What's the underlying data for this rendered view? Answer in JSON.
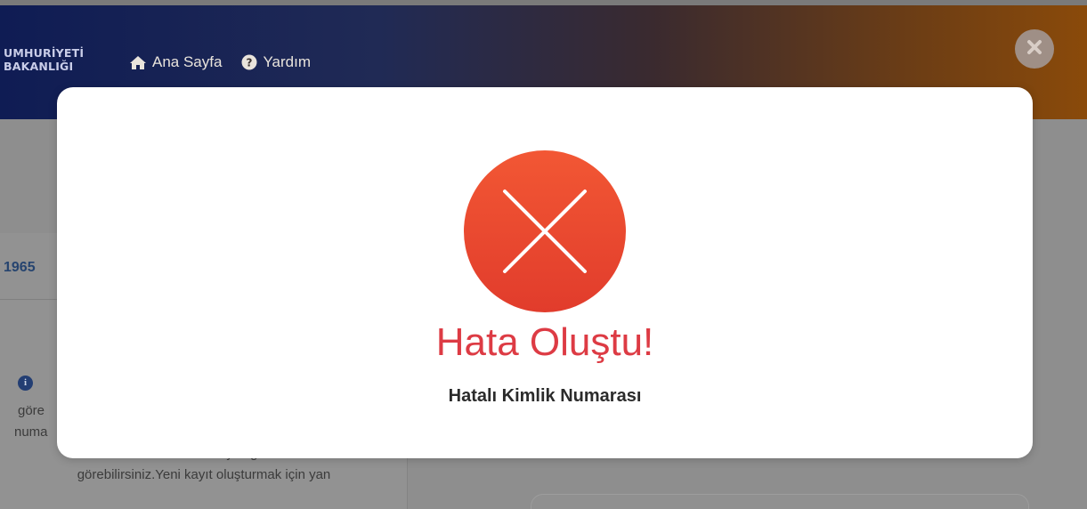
{
  "header": {
    "brand_line1": "UMHURİYETİ",
    "brand_line2": "BAKANLIĞI",
    "nav": [
      {
        "label": "Ana Sayfa",
        "icon": "home-icon"
      },
      {
        "label": "Yardım",
        "icon": "question-circle-icon"
      }
    ],
    "close_icon": "close-icon"
  },
  "background": {
    "year_value": "1965",
    "info_icon": "info-icon",
    "info_lines": [
      "göre",
      "numa",
      "durumunu ve detay bilgilerini",
      "görebilirsiniz.Yeni kayıt oluşturmak için yan"
    ]
  },
  "modal": {
    "icon": "error-x-icon",
    "title": "Hata Oluştu!",
    "message": "Hatalı Kimlik Numarası"
  },
  "colors": {
    "error_red": "#e8472f",
    "title_red": "#dd3b44",
    "header_blue": "#0f1c54",
    "header_orange": "#8a4a0a"
  }
}
